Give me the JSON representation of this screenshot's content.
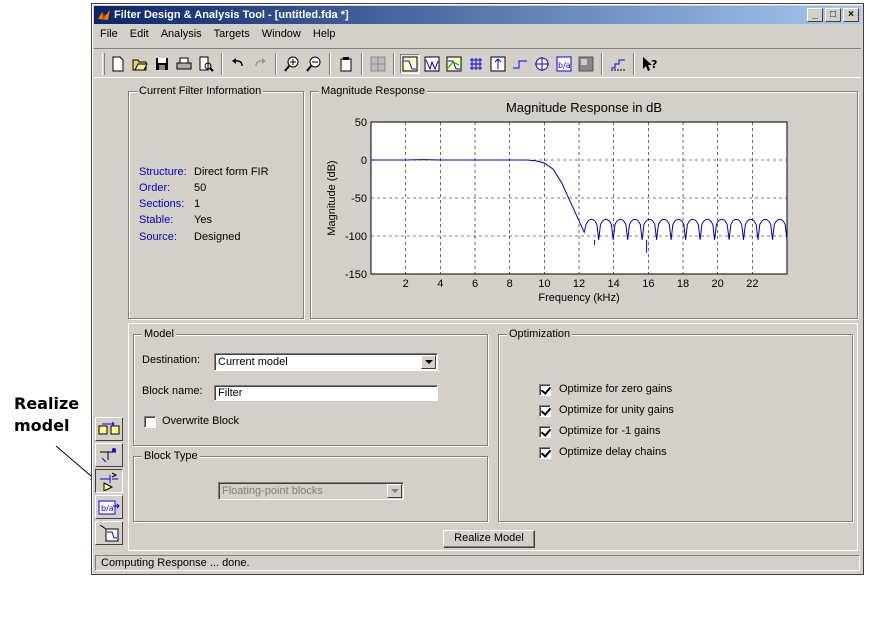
{
  "window": {
    "title": "Filter Design & Analysis Tool - [untitled.fda *]",
    "controls": [
      "minimize",
      "maximize",
      "close"
    ]
  },
  "menubar": [
    "File",
    "Edit",
    "Analysis",
    "Targets",
    "Window",
    "Help"
  ],
  "toolbar": {
    "icons": [
      "new-icon",
      "open-icon",
      "save-icon",
      "print-icon",
      "print-preview-icon",
      "undo-icon",
      "redo-icon",
      "zoom-in-icon",
      "zoom-out-icon",
      "full-view-icon",
      "filter-info-icon",
      "magnitude-response-icon",
      "phase-response-icon",
      "magnitude-phase-icon",
      "group-delay-icon",
      "impulse-response-icon",
      "step-response-icon",
      "pole-zero-icon",
      "filter-coefficients-icon",
      "filter-information-icon",
      "legend-icon",
      "whats-this-icon"
    ]
  },
  "filter_info": {
    "title": "Current Filter Information",
    "rows": [
      {
        "key": "Structure:",
        "value": "Direct form FIR"
      },
      {
        "key": "Order:",
        "value": "50"
      },
      {
        "key": "Sections:",
        "value": "1"
      },
      {
        "key": "Stable:",
        "value": "Yes"
      },
      {
        "key": "Source:",
        "value": "Designed"
      }
    ]
  },
  "magnitude_panel": {
    "title": "Magnitude Response"
  },
  "chart_data": {
    "type": "line",
    "title": "Magnitude Response in dB",
    "xlabel": "Frequency (kHz)",
    "ylabel": "Magnitude (dB)",
    "xlim": [
      0,
      24
    ],
    "ylim": [
      -150,
      50
    ],
    "xticks": [
      2,
      4,
      6,
      8,
      10,
      12,
      14,
      16,
      18,
      20,
      22
    ],
    "yticks": [
      50,
      0,
      -50,
      -100,
      -150
    ],
    "grid": true,
    "series": [
      {
        "color": "#0000c0",
        "x": [
          0,
          1,
          2,
          3,
          4,
          5,
          6,
          7,
          8,
          9,
          9.5,
          10,
          10.5,
          11,
          11.5,
          12,
          12.3
        ],
        "y": [
          0,
          0,
          0,
          0.5,
          0,
          0,
          0,
          0,
          0,
          0,
          -1,
          -4,
          -12,
          -30,
          -55,
          -80,
          -95
        ]
      }
    ],
    "stopband": {
      "x_start": 12.3,
      "x_end": 24,
      "peak_db": -78,
      "null_db": -105,
      "deep_nulls": [
        {
          "x": 12.9,
          "y": -112
        },
        {
          "x": 15.9,
          "y": -122
        }
      ]
    }
  },
  "model_panel": {
    "title": "Model",
    "destination_label": "Destination:",
    "destination_value": "Current model",
    "block_name_label": "Block name:",
    "block_name_value": "Filter",
    "overwrite_label": "Overwrite Block",
    "overwrite_checked": false
  },
  "block_type_panel": {
    "title": "Block Type",
    "value": "Floating-point blocks"
  },
  "optimization_panel": {
    "title": "Optimization",
    "options": [
      {
        "label": "Optimize for zero gains",
        "checked": true
      },
      {
        "label": "Optimize for unity gains",
        "checked": true
      },
      {
        "label": "Optimize for -1 gains",
        "checked": true
      },
      {
        "label": "Optimize delay chains",
        "checked": true
      }
    ]
  },
  "realize_button": "Realize Model",
  "status": "Computing Response ... done.",
  "annotation": {
    "line1": "Realize",
    "line2": "model"
  },
  "colors": {
    "face": "#d4d0c8",
    "title_start": "#0a246a",
    "title_end": "#a6caf0",
    "info_key": "#0000c0",
    "trace": "#0000c0"
  }
}
